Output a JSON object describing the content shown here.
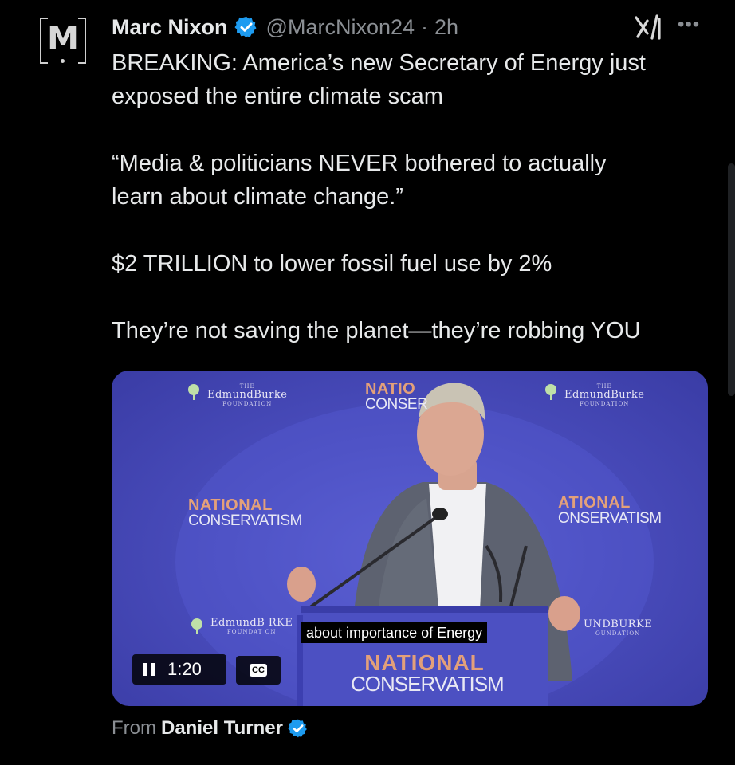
{
  "post": {
    "author_name": "Marc Nixon",
    "author_handle": "@MarcNixon24",
    "separator": "·",
    "time": "2h",
    "avatar_letter": "M",
    "more_label": "•••",
    "text": {
      "line1": "BREAKING: America’s new Secretary of Energy just",
      "line2": "exposed the entire climate scam",
      "quote1": "“Media & politicians NEVER bothered to actually",
      "quote2": "learn about climate change.”",
      "stat": "$2 TRILLION to lower fossil fuel use by 2%",
      "closing": "They’re not saving the planet—they’re robbing YOU"
    }
  },
  "video": {
    "signage": {
      "brand_name": "EdmundBurke",
      "brand_the": "THE",
      "brand_sub": "FOUNDATION",
      "top_center_1": "NATIO",
      "top_center_2": "CONSER",
      "left_1": "NATIONAL",
      "left_2": "CONSERVATISM",
      "right_1": "ATIONAL",
      "right_2": "ONSERVATISM",
      "bottom_left_brand": "EdmundB RKE",
      "bottom_left_sub": "FOUNDAT ON",
      "bottom_right_brand": "UNDBURKE",
      "bottom_right_sub": "OUNDATION",
      "podium_1": "NATIONAL",
      "podium_2": "CONSERVATISM"
    },
    "caption": "about importance of Energy",
    "elapsed": "1:20",
    "cc_label": "CC"
  },
  "footer": {
    "from_label": "From",
    "source_name": "Daniel Turner"
  },
  "colors": {
    "background": "#000000",
    "text": "#e7e9ea",
    "muted": "#8b8f94",
    "verified_blue": "#1d9bf0",
    "stage_blue": "#4a4dbd",
    "signage_orange": "#e3a07a"
  }
}
